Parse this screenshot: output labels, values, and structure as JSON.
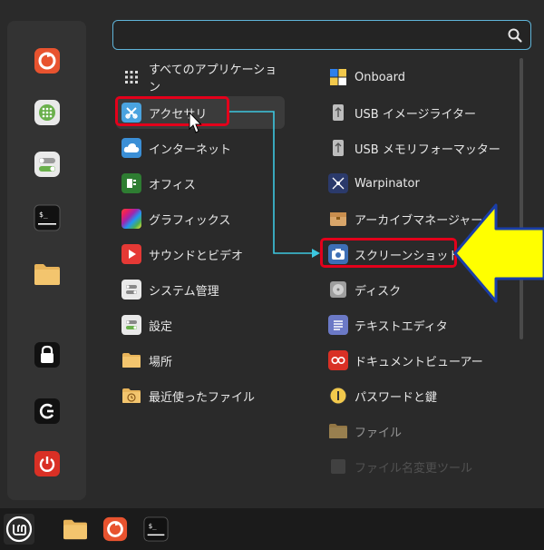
{
  "search": {
    "placeholder": "",
    "value": ""
  },
  "favorites": [
    {
      "name": "firefox-icon"
    },
    {
      "name": "software-manager-icon"
    },
    {
      "name": "settings-toggles-icon"
    },
    {
      "name": "terminal-icon"
    },
    {
      "name": "files-folder-icon"
    },
    {
      "name": "lock-screen-icon"
    },
    {
      "name": "logout-icon"
    },
    {
      "name": "power-icon"
    }
  ],
  "categories": [
    {
      "label": "すべてのアプリケーション",
      "icon": "grid-icon"
    },
    {
      "label": "アクセサリ",
      "icon": "accessories-icon",
      "active": true
    },
    {
      "label": "インターネット",
      "icon": "internet-cloud-icon"
    },
    {
      "label": "オフィス",
      "icon": "office-icon"
    },
    {
      "label": "グラフィックス",
      "icon": "graphics-icon"
    },
    {
      "label": "サウンドとビデオ",
      "icon": "sound-video-icon"
    },
    {
      "label": "システム管理",
      "icon": "system-admin-icon"
    },
    {
      "label": "設定",
      "icon": "settings-icon"
    },
    {
      "label": "場所",
      "icon": "places-folder-icon"
    },
    {
      "label": "最近使ったファイル",
      "icon": "recent-files-icon"
    }
  ],
  "apps": [
    {
      "label": "Onboard",
      "icon": "onboard-keyboard-icon"
    },
    {
      "label": "USB イメージライター",
      "icon": "usb-image-writer-icon"
    },
    {
      "label": "USB メモリフォーマッター",
      "icon": "usb-formatter-icon"
    },
    {
      "label": "Warpinator",
      "icon": "warpinator-icon"
    },
    {
      "label": "アーカイブマネージャー",
      "icon": "archive-manager-icon"
    },
    {
      "label": "スクリーンショット",
      "icon": "screenshot-camera-icon"
    },
    {
      "label": "ディスク",
      "icon": "disks-icon"
    },
    {
      "label": "テキストエディタ",
      "icon": "text-editor-icon"
    },
    {
      "label": "ドキュメントビューアー",
      "icon": "document-viewer-icon"
    },
    {
      "label": "パスワードと鍵",
      "icon": "passwords-keys-icon"
    },
    {
      "label": "ファイル",
      "icon": "files-icon"
    },
    {
      "label": "ファイル名変更ツール",
      "icon": "file-rename-icon"
    }
  ],
  "taskbar": [
    {
      "name": "mint-menu-icon"
    },
    {
      "name": "files-folder-icon"
    },
    {
      "name": "firefox-icon"
    },
    {
      "name": "terminal-icon"
    }
  ],
  "colors": {
    "highlight_box": "#e3001b",
    "arrow_line": "#3cc7e0",
    "big_arrow_fill": "#ffff00",
    "big_arrow_stroke": "#1a3ea8",
    "search_border": "#5fb4d9"
  }
}
